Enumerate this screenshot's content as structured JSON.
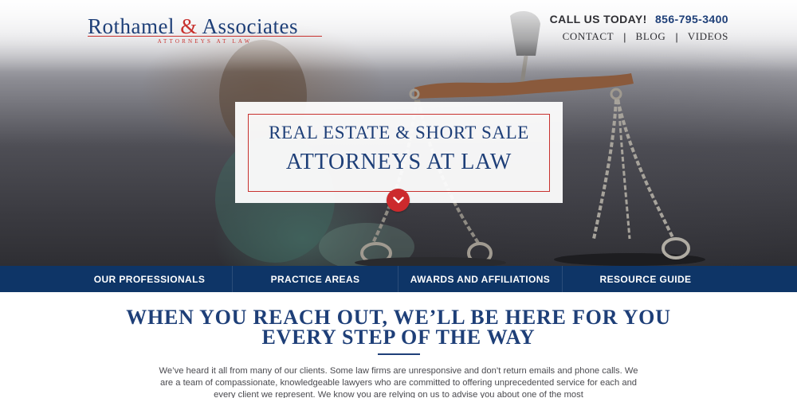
{
  "brand": {
    "name_part1": "Rothamel",
    "ampersand": "&",
    "name_part2": "Associates",
    "tagline": "ATTORNEYS AT LAW"
  },
  "header": {
    "call_label": "CALL US TODAY!",
    "phone": "856-795-3400",
    "links": [
      "CONTACT",
      "BLOG",
      "VIDEOS"
    ],
    "separator": "|"
  },
  "hero": {
    "line1": "REAL ESTATE & SHORT SALE",
    "line2": "ATTORNEYS AT LAW",
    "scroll_icon": "chevron-down-icon"
  },
  "nav": {
    "items": [
      "OUR PROFESSIONALS",
      "PRACTICE AREAS",
      "AWARDS AND AFFILIATIONS",
      "RESOURCE GUIDE"
    ]
  },
  "main": {
    "headline_line1": "WHEN YOU REACH OUT, WE’LL BE HERE FOR YOU",
    "headline_line2": "EVERY STEP OF THE WAY",
    "body": "We’ve heard it all from many of our clients. Some law firms are unresponsive and don’t return emails and phone calls. We are a team of compassionate, knowledgeable lawyers who are committed to offering unprecedented service for each and every client we represent. We know you are relying on us to advise you about one of the most"
  },
  "colors": {
    "brand_blue": "#1e3f78",
    "brand_red": "#c8312e",
    "nav_bg": "#0e3567"
  }
}
